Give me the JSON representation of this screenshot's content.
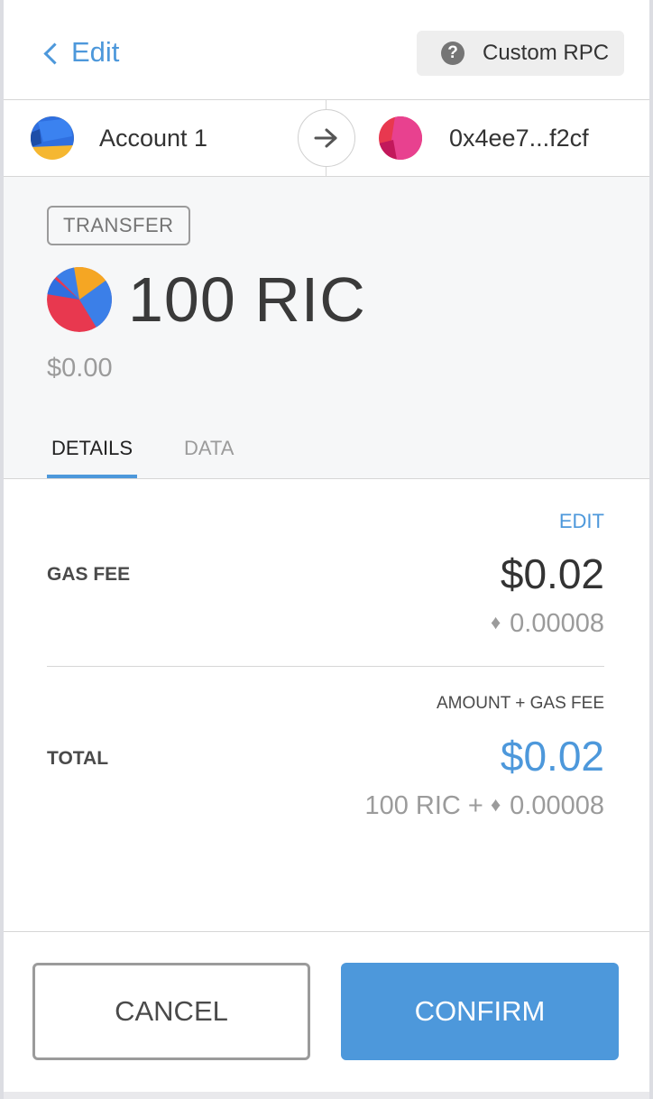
{
  "header": {
    "back_label": "Edit",
    "network": {
      "label": "Custom RPC",
      "icon": "help-icon"
    }
  },
  "accounts": {
    "from": {
      "name": "Account 1"
    },
    "to": {
      "name": "0x4ee7...f2cf"
    }
  },
  "summary": {
    "action": "TRANSFER",
    "amount": "100 RIC",
    "fiat": "$0.00",
    "tabs": [
      {
        "label": "DETAILS",
        "active": true
      },
      {
        "label": "DATA",
        "active": false
      }
    ]
  },
  "details": {
    "edit_label": "EDIT",
    "gas_fee": {
      "label": "GAS FEE",
      "fiat": "$0.02",
      "eth": "0.00008"
    },
    "total": {
      "header": "AMOUNT + GAS FEE",
      "label": "TOTAL",
      "fiat": "$0.02",
      "amount": "100 RIC +",
      "eth": "0.00008"
    }
  },
  "footer": {
    "cancel_label": "CANCEL",
    "confirm_label": "CONFIRM"
  },
  "colors": {
    "primary": "#4d98db",
    "text": "#333333",
    "muted": "#9b9b9b"
  }
}
